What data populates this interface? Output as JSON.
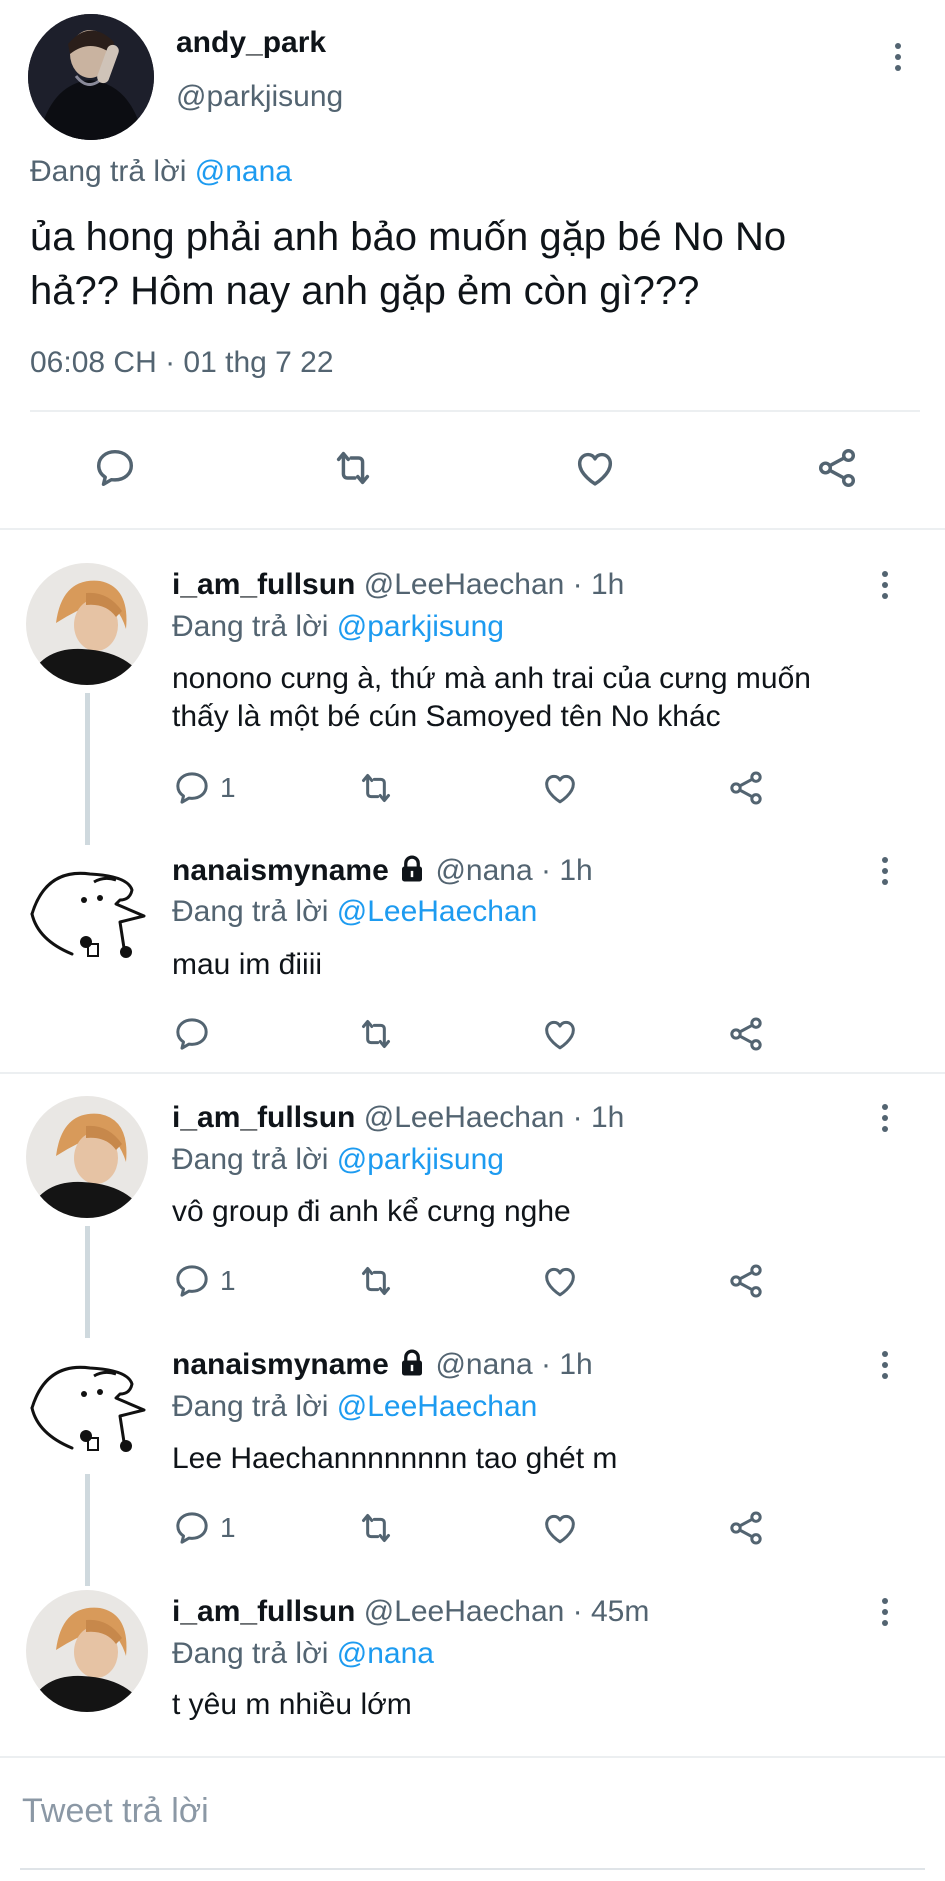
{
  "main_tweet": {
    "display_name": "andy_park",
    "handle": "@parkjisung",
    "reply_prefix": "Đang trả lời",
    "reply_to": "@nana",
    "text_line1": "ủa hong phải anh bảo muốn gặp bé No No",
    "text_line2": "hả?? Hôm nay anh gặp ẻm còn gì???",
    "timestamp": "06:08 CH · 01 thg 7 22"
  },
  "replies": [
    {
      "display_name": "i_am_fullsun",
      "handle_time": "@LeeHaechan · 1h",
      "reply_prefix": "Đang trả lời",
      "reply_to": "@parkjisung",
      "text_line1": "nonono cưng à, thứ mà anh trai của cưng muốn",
      "text_line2": "thấy là một bé cún Samoyed tên No khác",
      "reply_count": "1",
      "locked": false
    },
    {
      "display_name": "nanaismyname",
      "handle_time": "@nana · 1h",
      "reply_prefix": "Đang trả lời",
      "reply_to": "@LeeHaechan",
      "text_line1": "mau im điiii",
      "reply_count": "",
      "locked": true
    },
    {
      "display_name": "i_am_fullsun",
      "handle_time": "@LeeHaechan · 1h",
      "reply_prefix": "Đang trả lời",
      "reply_to": "@parkjisung",
      "text_line1": "vô group đi anh kể cưng nghe",
      "reply_count": "1",
      "locked": false
    },
    {
      "display_name": "nanaismyname",
      "handle_time": "@nana · 1h",
      "reply_prefix": "Đang trả lời",
      "reply_to": "@LeeHaechan",
      "text_line1": "Lee Haechannnnnnnn tao ghét m",
      "reply_count": "1",
      "locked": true
    },
    {
      "display_name": "i_am_fullsun",
      "handle_time": "@LeeHaechan · 45m",
      "reply_prefix": "Đang trả lời",
      "reply_to": "@nana",
      "text_line1": "t yêu m nhiều lớm",
      "locked": false
    }
  ],
  "compose": {
    "placeholder": "Tweet trả lời"
  },
  "icons": [
    "more-vertical-icon",
    "reply-icon",
    "retweet-icon",
    "like-icon",
    "share-icon",
    "lock-icon"
  ],
  "colors": {
    "accent": "#1d9bf0",
    "secondary_text": "#536471",
    "divider": "#eceff1",
    "thread_line": "#cfd9de"
  }
}
